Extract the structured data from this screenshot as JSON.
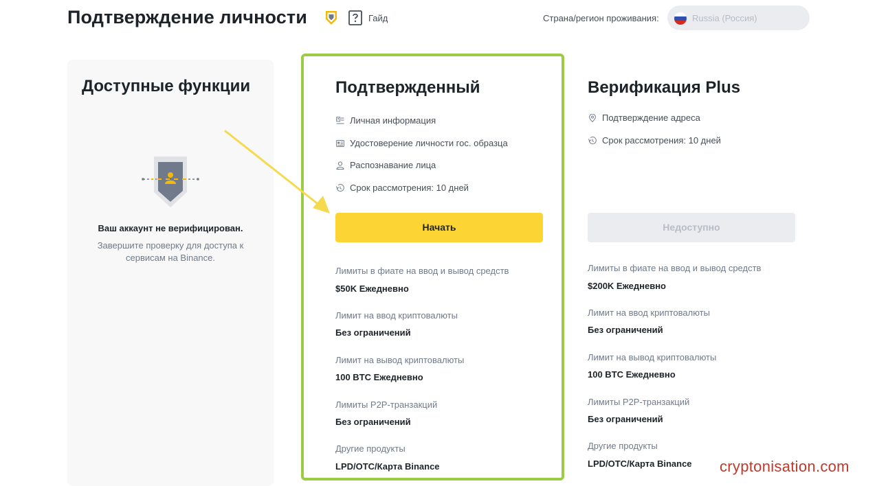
{
  "header": {
    "title": "Подтверждение личности",
    "guide_label": "Гайд",
    "country_label": "Страна/регион проживания:",
    "country_value": "Russia (Россия)"
  },
  "features": {
    "title": "Доступные функции",
    "status_title": "Ваш аккаунт не верифицирован.",
    "status_desc": "Завершите проверку для доступа к сервисам на Binance."
  },
  "verified": {
    "title": "Подтвержденный",
    "requirements": [
      {
        "icon": "personal-info-icon",
        "label": "Личная информация"
      },
      {
        "icon": "id-card-icon",
        "label": "Удостоверение личности гос. образца"
      },
      {
        "icon": "face-icon",
        "label": "Распознавание лица"
      },
      {
        "icon": "clock-icon",
        "label": "Срок рассмотрения: 10 дней"
      }
    ],
    "button": "Начать",
    "limits": [
      {
        "label": "Лимиты в фиате на ввод и вывод средств",
        "value": "$50K Ежедневно"
      },
      {
        "label": "Лимит на ввод криптовалюты",
        "value": "Без ограничений"
      },
      {
        "label": "Лимит на вывод криптовалюты",
        "value": "100 BTC Ежедневно"
      },
      {
        "label": "Лимиты P2P-транзакций",
        "value": "Без ограничений"
      },
      {
        "label": "Другие продукты",
        "value": "LPD/OTC/Карта Binance"
      }
    ]
  },
  "plus": {
    "title": "Верификация Plus",
    "requirements": [
      {
        "icon": "location-icon",
        "label": "Подтверждение адреса"
      },
      {
        "icon": "clock-icon",
        "label": "Срок рассмотрения: 10 дней"
      }
    ],
    "button": "Недоступно",
    "limits": [
      {
        "label": "Лимиты в фиате на ввод и вывод средств",
        "value": "$200K Ежедневно"
      },
      {
        "label": "Лимит на ввод криптовалюты",
        "value": "Без ограничений"
      },
      {
        "label": "Лимит на вывод криптовалюты",
        "value": "100 BTC Ежедневно"
      },
      {
        "label": "Лимиты P2P-транзакций",
        "value": "Без ограничений"
      },
      {
        "label": "Другие продукты",
        "value": "LPD/OTC/Карта Binance"
      }
    ]
  },
  "watermark": "cryptonisation.com",
  "colors": {
    "accent": "#fcd535",
    "highlight_border": "#9ccc45",
    "arrow": "#f5d94e",
    "watermark": "#c0392b"
  }
}
